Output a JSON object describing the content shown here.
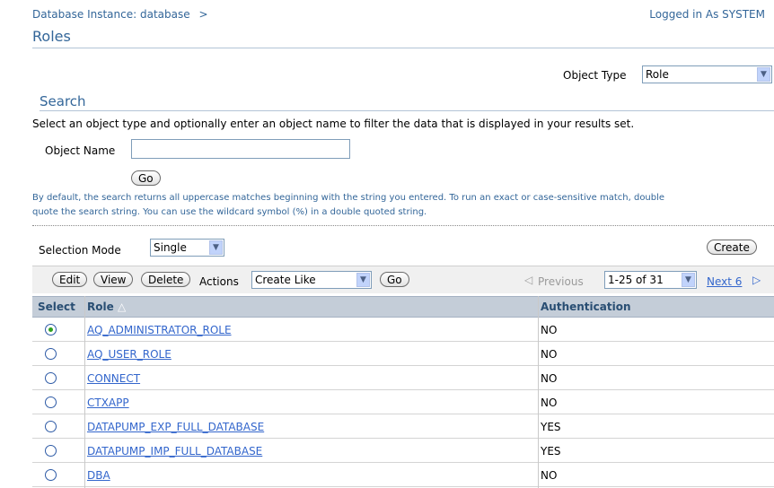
{
  "header": {
    "breadcrumb": "Database Instance: database",
    "breadcrumb_separator": ">",
    "logged_in": "Logged in As SYSTEM",
    "page_title": "Roles"
  },
  "object_type": {
    "label": "Object Type",
    "value": "Role"
  },
  "search": {
    "heading": "Search",
    "instructions": "Select an object type and optionally enter an object name to filter the data that is displayed in your results set.",
    "name_label": "Object Name",
    "name_value": "",
    "go_label": "Go",
    "hint_line1": "By default, the search returns all uppercase matches beginning with the string you entered. To run an exact or case-sensitive match, double",
    "hint_line2": "quote the search string. You can use the wildcard symbol (%) in a double quoted string."
  },
  "selection": {
    "mode_label": "Selection Mode",
    "mode_value": "Single",
    "create_label": "Create"
  },
  "actions_bar": {
    "edit_label": "Edit",
    "view_label": "View",
    "delete_label": "Delete",
    "actions_label": "Actions",
    "actions_value": "Create Like",
    "go_label": "Go",
    "previous_label": "Previous",
    "range_value": "1-25 of 31",
    "next_label": "Next 6"
  },
  "table": {
    "col_select": "Select",
    "col_role": "Role",
    "col_auth": "Authentication",
    "rows": [
      {
        "role": "AQ_ADMINISTRATOR_ROLE",
        "auth": "NO",
        "selected": true
      },
      {
        "role": "AQ_USER_ROLE",
        "auth": "NO",
        "selected": false
      },
      {
        "role": "CONNECT",
        "auth": "NO",
        "selected": false
      },
      {
        "role": "CTXAPP",
        "auth": "NO",
        "selected": false
      },
      {
        "role": "DATAPUMP_EXP_FULL_DATABASE",
        "auth": "YES",
        "selected": false
      },
      {
        "role": "DATAPUMP_IMP_FULL_DATABASE",
        "auth": "YES",
        "selected": false
      },
      {
        "role": "DBA",
        "auth": "NO",
        "selected": false
      }
    ]
  },
  "colors": {
    "header_text": "#336699",
    "link": "#3366cc",
    "table_header_bg": "#c4cdd8"
  }
}
